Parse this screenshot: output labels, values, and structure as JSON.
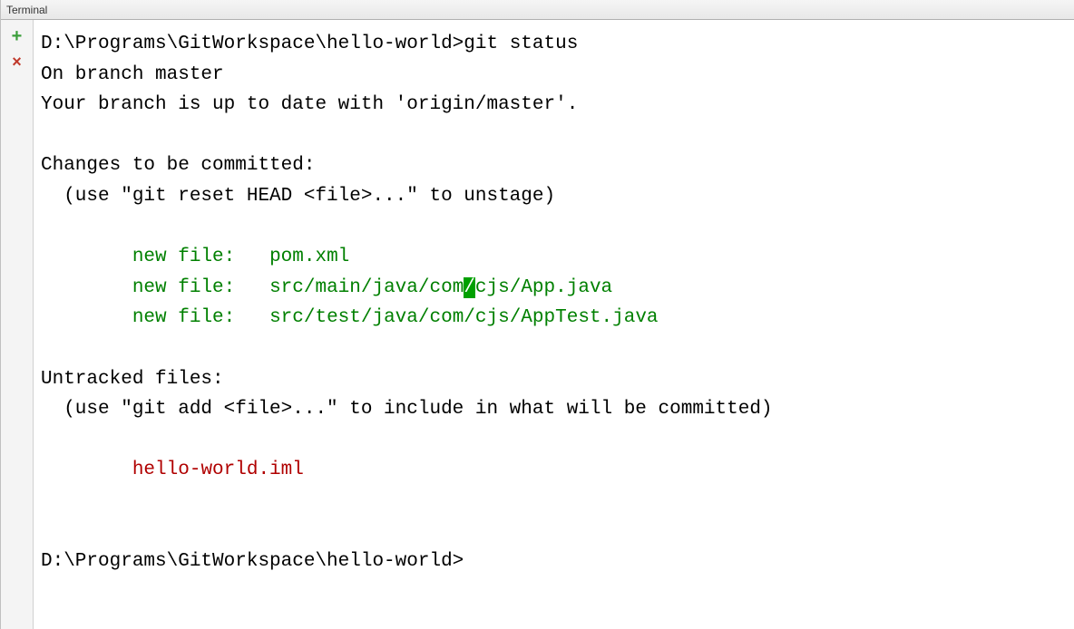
{
  "header": {
    "title": "Terminal"
  },
  "sidebar": {
    "add": "+",
    "close": "×"
  },
  "content": {
    "prompt1_path": "D:\\Programs\\GitWorkspace\\hello-world>",
    "prompt1_cmd": "git status",
    "line_branch": "On branch master",
    "line_uptodate": "Your branch is up to date with 'origin/master'.",
    "line_changes_header": "Changes to be committed:",
    "line_changes_hint": "  (use \"git reset HEAD <file>...\" to unstage)",
    "staged_indent": "        ",
    "staged1_label": "new file:   ",
    "staged1_file": "pom.xml",
    "staged2_label": "new file:   ",
    "staged2_file_a": "src/main/java/com",
    "staged2_cursor": "/",
    "staged2_file_b": "cjs/App.java",
    "staged3_label": "new file:   ",
    "staged3_file": "src/test/java/com/cjs/AppTest.java",
    "line_untracked_header": "Untracked files:",
    "line_untracked_hint": "  (use \"git add <file>...\" to include in what will be committed)",
    "untracked_indent": "        ",
    "untracked1_file": "hello-world.iml",
    "prompt2_path": "D:\\Programs\\GitWorkspace\\hello-world>"
  }
}
